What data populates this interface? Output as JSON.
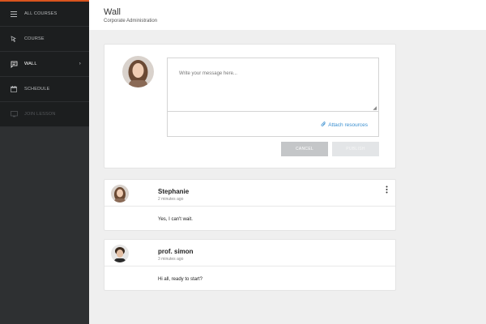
{
  "sidebar": {
    "items": [
      {
        "label": "ALL COURSES",
        "icon": "menu-icon"
      },
      {
        "label": "COURSE",
        "icon": "cursor-icon"
      },
      {
        "label": "WALL",
        "icon": "chat-icon",
        "active": true
      },
      {
        "label": "SCHEDULE",
        "icon": "calendar-icon"
      },
      {
        "label": "JOIN LESSON",
        "icon": "monitor-icon",
        "disabled": true
      }
    ],
    "chevron": "›"
  },
  "header": {
    "title": "Wall",
    "subtitle": "Corporate Administration"
  },
  "composer": {
    "placeholder": "Write your message here...",
    "attach_label": "Attach resources",
    "cancel_label": "CANCEL",
    "publish_label": "PUBLISH"
  },
  "posts": [
    {
      "author": "Stephanie",
      "time": "2 minutes ago",
      "text": "Yes, I can't wait."
    },
    {
      "author": "prof. simon",
      "time": "3 minutes ago",
      "text": "Hi all, ready to start?"
    }
  ],
  "colors": {
    "accent": "#d9541e",
    "link": "#3a8fd0",
    "sidebar_bg": "#2e3032"
  }
}
